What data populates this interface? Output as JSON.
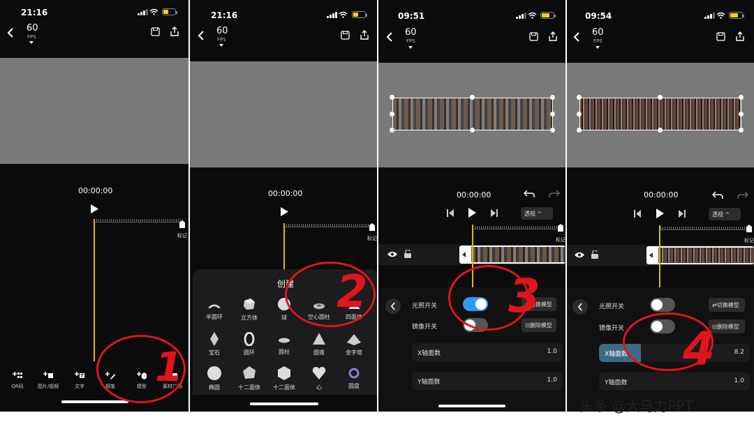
{
  "panels": [
    {
      "status_time": "21:16",
      "fps_value": "60",
      "fps_label": "FPS",
      "timecode": "00:00:00",
      "marker_label": "标记",
      "toolbar": [
        {
          "label": "QR码",
          "icon": "qr-icon"
        },
        {
          "label": "图片/视频",
          "icon": "image-icon"
        },
        {
          "label": "文字",
          "icon": "text-icon"
        },
        {
          "label": "钢笔",
          "icon": "pen-icon"
        },
        {
          "label": "模型",
          "icon": "model-icon"
        },
        {
          "label": "素材广场",
          "icon": "asset-icon"
        }
      ],
      "annotation_number": "1"
    },
    {
      "status_time": "21:16",
      "fps_value": "60",
      "fps_label": "FPS",
      "timecode": "00:00:00",
      "marker_label": "标记",
      "sheet_title": "创建",
      "shapes_row1": [
        "半圆环",
        "立方体",
        "球",
        "空心圆柱",
        "四面体"
      ],
      "shapes_row2": [
        "宝石",
        "圆环",
        "圆柱",
        "圆锥",
        "金字塔"
      ],
      "shapes_row3": [
        "椭圆",
        "十二面体",
        "十二面体",
        "心",
        "圆盘"
      ],
      "annotation_number": "2"
    },
    {
      "status_time": "09:51",
      "fps_value": "60",
      "fps_label": "FPS",
      "timecode": "00:00:00",
      "marker_label": "标记",
      "perspective_label": "透视 ^",
      "light_switch_label": "光照开关",
      "light_switch_on": true,
      "mirror_switch_label": "镜像开关",
      "mirror_switch_on": false,
      "switch_model_label": "⇄切换模型",
      "delete_model_label": "⊡删除模型",
      "x_faces_label": "X轴面数",
      "x_faces_value": "1.0",
      "y_faces_label": "Y轴面数",
      "y_faces_value": "1.0",
      "annotation_number": "3"
    },
    {
      "status_time": "09:54",
      "fps_value": "60",
      "fps_label": "FPS",
      "timecode": "00:00:00",
      "marker_label": "标记",
      "perspective_label": "透视 ^",
      "light_switch_label": "光照开关",
      "light_switch_on": false,
      "mirror_switch_label": "镜像开关",
      "mirror_switch_on": false,
      "switch_model_label": "⇄切换模型",
      "delete_model_label": "⊡删除模型",
      "x_faces_label": "X轴面数",
      "x_faces_value": "8.2",
      "x_faces_fill": 0.28,
      "y_faces_label": "Y轴面数",
      "y_faces_value": "1.0",
      "annotation_number": "4"
    }
  ],
  "watermark": "头条 @大马力PPT",
  "colors": {
    "annotation_red": "#e1141b",
    "toggle_on": "#2e9bef",
    "timeline_cursor": "#e6b800",
    "slider_fill": "#3b6a85"
  }
}
